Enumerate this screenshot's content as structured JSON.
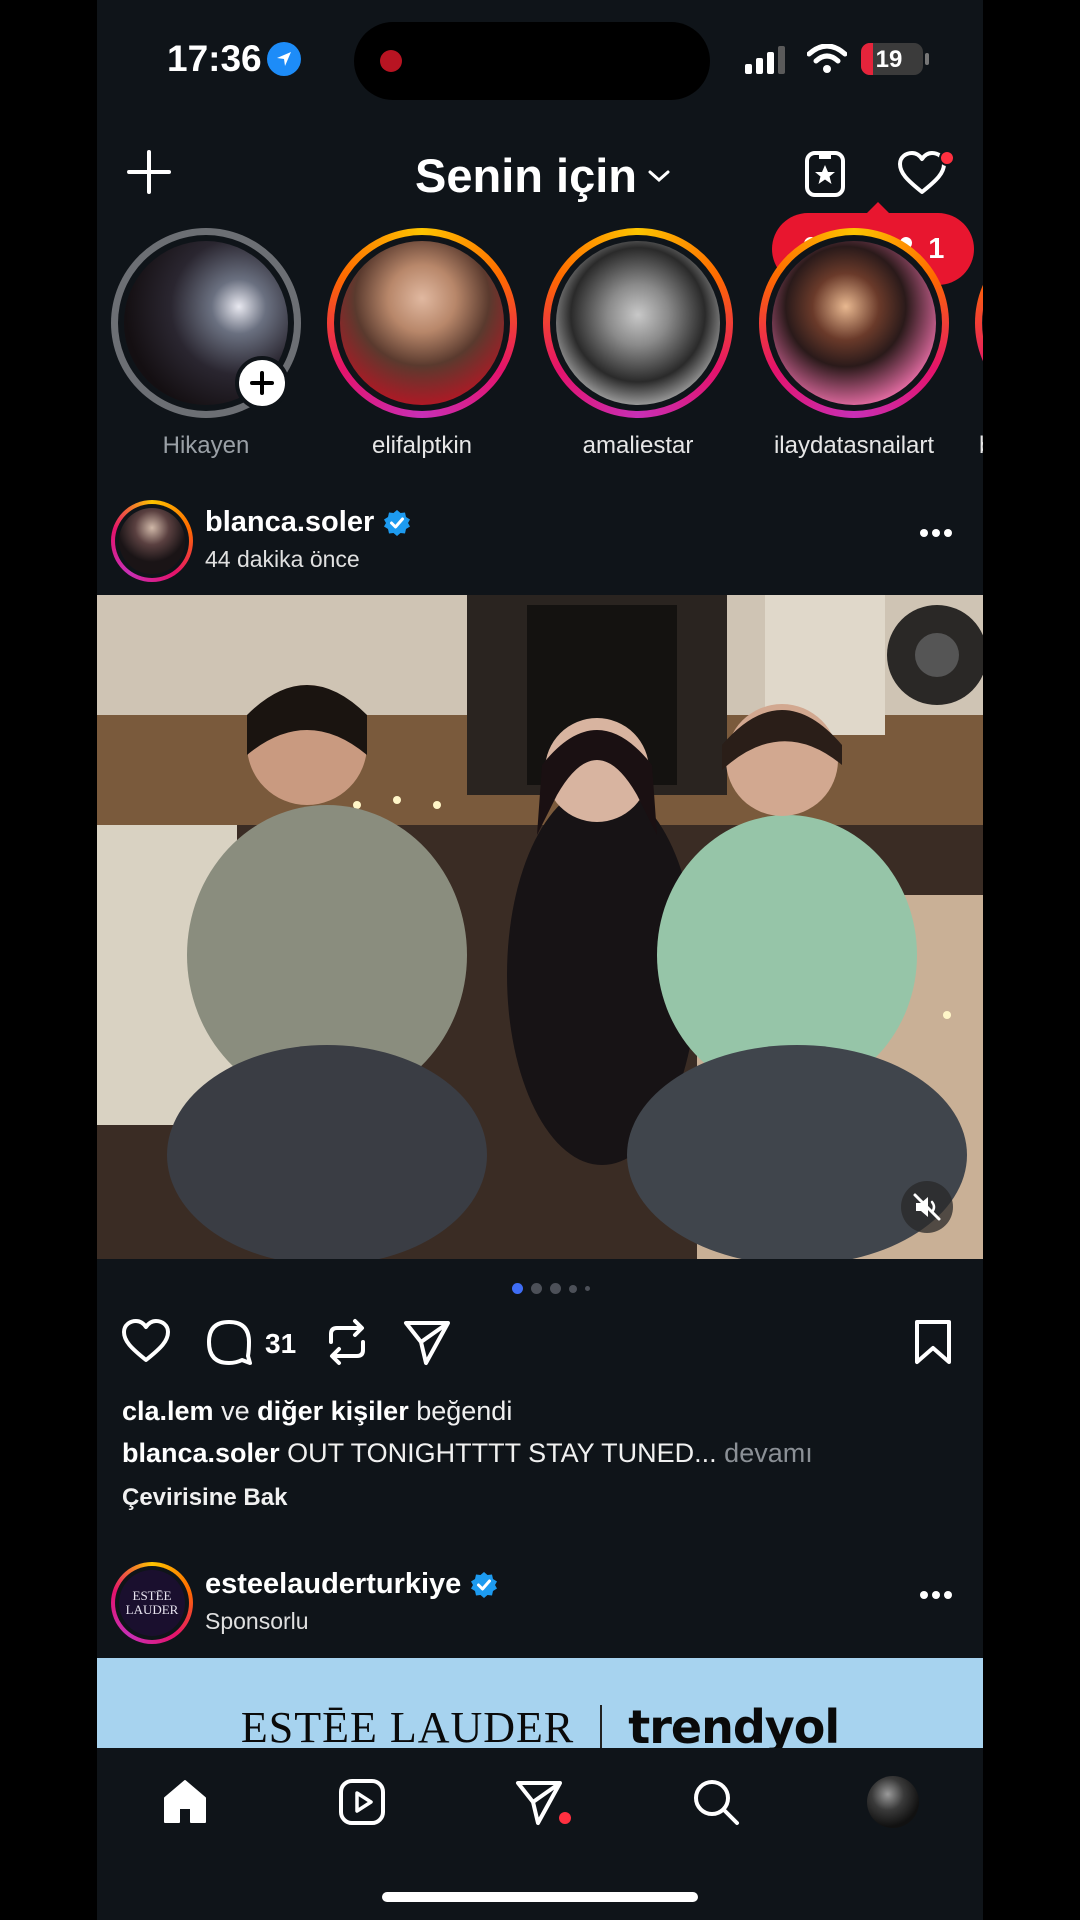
{
  "status_bar": {
    "time": "17:36",
    "battery": "19",
    "battery_level": 0.19
  },
  "header": {
    "title": "Senin için",
    "plus_icon": "plus-icon",
    "favorites_icon": "favorites-star-icon",
    "activity_icon": "heart-icon",
    "activity_likes": "11",
    "activity_followers": "1"
  },
  "stories": [
    {
      "name": "Hikayen",
      "own": true
    },
    {
      "name": "elifalptkin",
      "own": false
    },
    {
      "name": "amaliestar",
      "own": false
    },
    {
      "name": "ilaydatasnailart",
      "own": false
    },
    {
      "name": "b",
      "own": false
    }
  ],
  "post": {
    "username": "blanca.soler",
    "verified": true,
    "time": "44 dakika önce",
    "comments": "31",
    "liked_by_user": "cla.lem",
    "liked_by_connector": "ve",
    "liked_by_others": "diğer kişiler",
    "liked_by_suffix": "beğendi",
    "caption_user": "blanca.soler",
    "caption_text": "OUT TONIGHTTTT STAY TUNED...",
    "caption_more": "devamı",
    "translate": "Çevirisine Bak",
    "carousel_total": 5,
    "carousel_index": 1
  },
  "sponsored_post": {
    "username": "esteelauderturkiye",
    "verified": true,
    "label": "Sponsorlu",
    "avatar_text_1": "ESTĒE",
    "avatar_text_2": "LAUDER",
    "banner_brand_1": "ESTĒE LAUDER",
    "banner_brand_2": "trendyol"
  },
  "nav": [
    "home-icon",
    "reels-icon",
    "direct-icon",
    "search-icon",
    "profile-avatar"
  ],
  "colors": {
    "background": "#0f1419",
    "accent_red": "#e8162f",
    "verified_blue": "#1d9bf0",
    "carousel_active": "#3f6df5"
  }
}
